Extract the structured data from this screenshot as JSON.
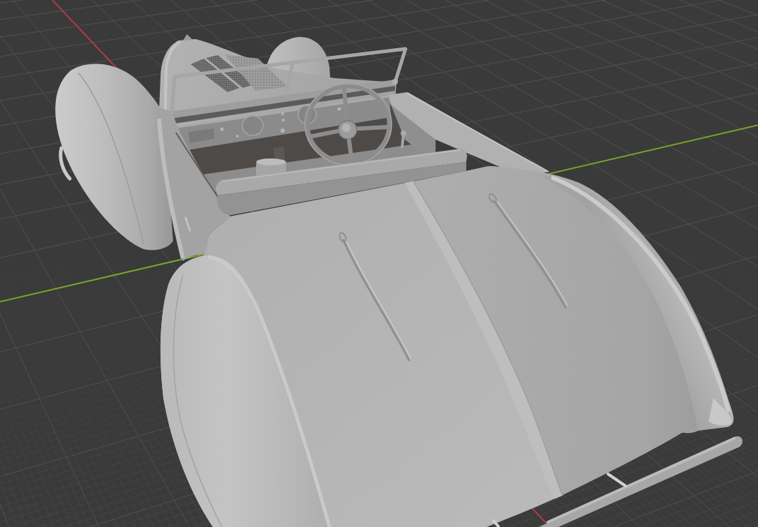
{
  "viewport": {
    "axes": [
      {
        "kind": "x",
        "color": "#af3c46"
      },
      {
        "kind": "y",
        "color": "#78a528"
      }
    ]
  }
}
